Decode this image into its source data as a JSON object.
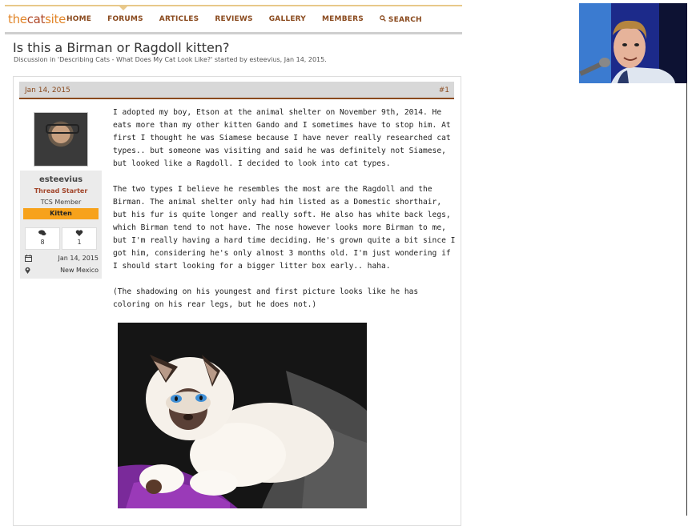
{
  "site": {
    "logo_part1": "the",
    "logo_part2": "cat",
    "logo_part3": "site"
  },
  "nav": {
    "items": [
      "HOME",
      "FORUMS",
      "ARTICLES",
      "REVIEWS",
      "GALLERY",
      "MEMBERS"
    ],
    "search_label": "SEARCH"
  },
  "thread": {
    "title": "Is this a Birman or Ragdoll kitten?",
    "subtitle": "Discussion in 'Describing Cats - What Does My Cat Look Like?' started by esteevius, Jan 14, 2015."
  },
  "post": {
    "date": "Jan 14, 2015",
    "number": "#1",
    "user": {
      "name": "esteevius",
      "role": "Thread Starter",
      "member_type": "TCS Member",
      "badge": "Kitten",
      "messages": "8",
      "likes": "1",
      "joined": "Jan 14, 2015",
      "location": "New Mexico"
    },
    "paragraphs": [
      "I adopted my boy, Etson at the animal shelter on November 9th, 2014. He eats more than my other kitten Gando and I sometimes have to stop him. At first I thought he was Siamese because I have never really researched cat types.. but someone was visiting and said he was definitely not Siamese, but looked like a Ragdoll. I decided to look into cat types.",
      "The two types I believe he resembles the most are the Ragdoll and the Birman. The animal shelter only had him listed as a Domestic shorthair, but his fur is quite longer and really soft. He also has white back legs, which Birman tend to not have. The nose however looks more Birman to me, but I'm really having a hard time deciding. He's grown quite a bit since I got him, considering he's only almost 3 months old. I'm just wondering if I should start looking for a bigger litter box early.. haha.",
      "(The shadowing on his youngest and first picture looks like he has coloring on his rear legs, but he does not.)"
    ]
  },
  "colors": {
    "accent": "#8a4a1e",
    "badge": "#f7a21b",
    "role": "#a2452a"
  }
}
